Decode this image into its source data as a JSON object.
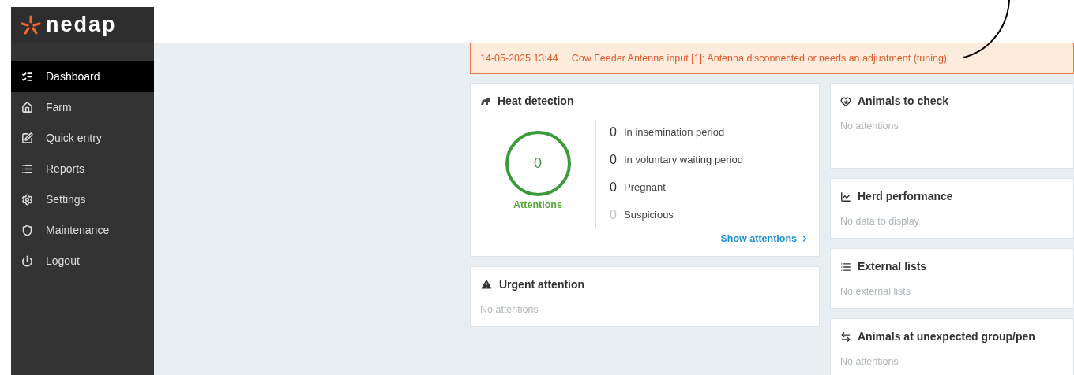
{
  "logo": {
    "text": "nedap"
  },
  "sidebar": {
    "items": [
      {
        "label": "Dashboard",
        "selected": true
      },
      {
        "label": "Farm",
        "selected": false
      },
      {
        "label": "Quick entry",
        "selected": false
      },
      {
        "label": "Reports",
        "selected": false
      },
      {
        "label": "Settings",
        "selected": false
      },
      {
        "label": "Maintenance",
        "selected": false
      },
      {
        "label": "Logout",
        "selected": false
      }
    ]
  },
  "alert": {
    "time": "14-05-2025 13:44",
    "message": "Cow Feeder Antenna input [1]: Antenna disconnected or needs an adjustment (tuning)"
  },
  "heat_detection": {
    "title": "Heat detection",
    "total": "0",
    "total_label": "Attentions",
    "counts": [
      {
        "value": "0",
        "label": "In insemination period",
        "muted": false
      },
      {
        "value": "0",
        "label": "In voluntary waiting period",
        "muted": false
      },
      {
        "value": "0",
        "label": "Pregnant",
        "muted": false
      },
      {
        "value": "0",
        "label": "Suspicious",
        "muted": true
      }
    ],
    "link": "Show attentions"
  },
  "urgent_attention": {
    "title": "Urgent attention",
    "empty": "No attentions"
  },
  "side_cards": [
    {
      "title": "Animals to check",
      "empty": "No attentions"
    },
    {
      "title": "Herd performance",
      "empty": "No data to display"
    },
    {
      "title": "External lists",
      "empty": "No external lists"
    },
    {
      "title": "Animals at unexpected group/pen",
      "empty": "No attentions"
    }
  ]
}
